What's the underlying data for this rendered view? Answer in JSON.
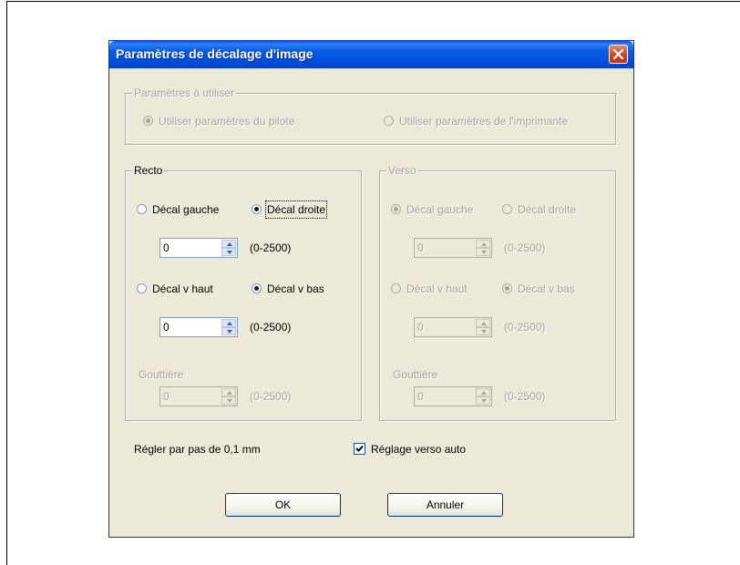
{
  "dialog": {
    "title": "Paramètres de décalage d'image"
  },
  "params_group": {
    "legend": "Paramètres à utiliser",
    "driver_label": "Utiliser paramètres du pilote",
    "printer_label": "Utiliser paramètres de l'imprimante",
    "selected": "driver"
  },
  "recto": {
    "legend": "Recto",
    "left_label": "Décal gauche",
    "right_label": "Décal droite",
    "horizontal_selected": "right",
    "horizontal_value": "0",
    "horizontal_range": "(0-2500)",
    "up_label": "Décal v haut",
    "down_label": "Décal v bas",
    "vertical_selected": "down",
    "vertical_value": "0",
    "vertical_range": "(0-2500)",
    "gutter_label": "Gouttière",
    "gutter_value": "0",
    "gutter_range": "(0-2500)"
  },
  "verso": {
    "legend": "Verso",
    "left_label": "Décal gauche",
    "right_label": "Décal droite",
    "horizontal_selected": "left",
    "horizontal_value": "0",
    "horizontal_range": "(0-2500)",
    "up_label": "Décal v haut",
    "down_label": "Décal v bas",
    "vertical_selected": "down",
    "vertical_value": "0",
    "vertical_range": "(0-2500)",
    "gutter_label": "Gouttière",
    "gutter_value": "0",
    "gutter_range": "(0-2500)"
  },
  "footer": {
    "step_note": "Régler par pas de 0,1 mm",
    "auto_verso_label": "Réglage verso auto",
    "auto_verso_checked": true,
    "ok_label": "OK",
    "cancel_label": "Annuler"
  },
  "icons": {
    "close": "close-icon",
    "spin_up": "spin-up-arrow-icon",
    "spin_down": "spin-down-arrow-icon",
    "check": "checkmark-icon"
  },
  "colors": {
    "titlebar": "#0a5de5",
    "dialog_bg": "#ece9d8",
    "close_button": "#d0451f",
    "disabled_text": "#a4a29a"
  }
}
